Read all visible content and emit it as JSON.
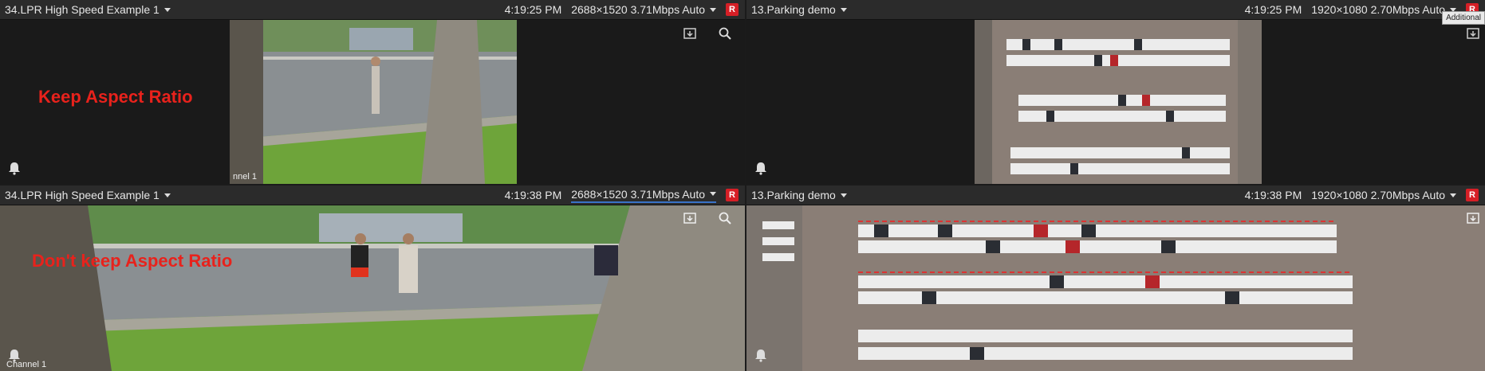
{
  "panes": [
    {
      "camera": "34.LPR High Speed Example 1",
      "time": "4:19:25 PM",
      "stream": "2688×1520 3.71Mbps Auto",
      "rec": "R",
      "note": "Keep Aspect Ratio",
      "channel": "nnel 1"
    },
    {
      "camera": "13.Parking demo",
      "time": "4:19:25 PM",
      "stream": "1920×1080 2.70Mbps Auto",
      "rec": "R",
      "tooltip": "Additional"
    },
    {
      "camera": "34.LPR High Speed Example 1",
      "time": "4:19:38 PM",
      "stream": "2688×1520 3.71Mbps Auto",
      "rec": "R",
      "note": "Don't keep Aspect Ratio",
      "channel": "Channel 1"
    },
    {
      "camera": "13.Parking demo",
      "time": "4:19:38 PM",
      "stream": "1920×1080 2.70Mbps Auto",
      "rec": "R"
    }
  ],
  "colors": {
    "note": "#e8221c",
    "rec": "#d61f26",
    "header": "#2b2b2b",
    "highlight": "#3a73c7"
  }
}
